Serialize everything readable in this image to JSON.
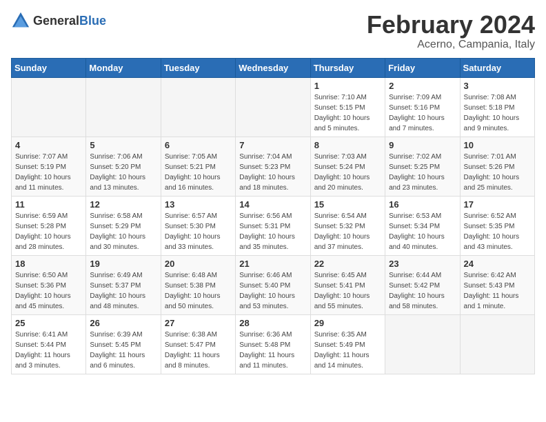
{
  "header": {
    "logo_general": "General",
    "logo_blue": "Blue",
    "main_title": "February 2024",
    "sub_title": "Acerno, Campania, Italy"
  },
  "calendar": {
    "days_of_week": [
      "Sunday",
      "Monday",
      "Tuesday",
      "Wednesday",
      "Thursday",
      "Friday",
      "Saturday"
    ],
    "weeks": [
      [
        {
          "day": "",
          "info": ""
        },
        {
          "day": "",
          "info": ""
        },
        {
          "day": "",
          "info": ""
        },
        {
          "day": "",
          "info": ""
        },
        {
          "day": "1",
          "info": "Sunrise: 7:10 AM\nSunset: 5:15 PM\nDaylight: 10 hours\nand 5 minutes."
        },
        {
          "day": "2",
          "info": "Sunrise: 7:09 AM\nSunset: 5:16 PM\nDaylight: 10 hours\nand 7 minutes."
        },
        {
          "day": "3",
          "info": "Sunrise: 7:08 AM\nSunset: 5:18 PM\nDaylight: 10 hours\nand 9 minutes."
        }
      ],
      [
        {
          "day": "4",
          "info": "Sunrise: 7:07 AM\nSunset: 5:19 PM\nDaylight: 10 hours\nand 11 minutes."
        },
        {
          "day": "5",
          "info": "Sunrise: 7:06 AM\nSunset: 5:20 PM\nDaylight: 10 hours\nand 13 minutes."
        },
        {
          "day": "6",
          "info": "Sunrise: 7:05 AM\nSunset: 5:21 PM\nDaylight: 10 hours\nand 16 minutes."
        },
        {
          "day": "7",
          "info": "Sunrise: 7:04 AM\nSunset: 5:23 PM\nDaylight: 10 hours\nand 18 minutes."
        },
        {
          "day": "8",
          "info": "Sunrise: 7:03 AM\nSunset: 5:24 PM\nDaylight: 10 hours\nand 20 minutes."
        },
        {
          "day": "9",
          "info": "Sunrise: 7:02 AM\nSunset: 5:25 PM\nDaylight: 10 hours\nand 23 minutes."
        },
        {
          "day": "10",
          "info": "Sunrise: 7:01 AM\nSunset: 5:26 PM\nDaylight: 10 hours\nand 25 minutes."
        }
      ],
      [
        {
          "day": "11",
          "info": "Sunrise: 6:59 AM\nSunset: 5:28 PM\nDaylight: 10 hours\nand 28 minutes."
        },
        {
          "day": "12",
          "info": "Sunrise: 6:58 AM\nSunset: 5:29 PM\nDaylight: 10 hours\nand 30 minutes."
        },
        {
          "day": "13",
          "info": "Sunrise: 6:57 AM\nSunset: 5:30 PM\nDaylight: 10 hours\nand 33 minutes."
        },
        {
          "day": "14",
          "info": "Sunrise: 6:56 AM\nSunset: 5:31 PM\nDaylight: 10 hours\nand 35 minutes."
        },
        {
          "day": "15",
          "info": "Sunrise: 6:54 AM\nSunset: 5:32 PM\nDaylight: 10 hours\nand 37 minutes."
        },
        {
          "day": "16",
          "info": "Sunrise: 6:53 AM\nSunset: 5:34 PM\nDaylight: 10 hours\nand 40 minutes."
        },
        {
          "day": "17",
          "info": "Sunrise: 6:52 AM\nSunset: 5:35 PM\nDaylight: 10 hours\nand 43 minutes."
        }
      ],
      [
        {
          "day": "18",
          "info": "Sunrise: 6:50 AM\nSunset: 5:36 PM\nDaylight: 10 hours\nand 45 minutes."
        },
        {
          "day": "19",
          "info": "Sunrise: 6:49 AM\nSunset: 5:37 PM\nDaylight: 10 hours\nand 48 minutes."
        },
        {
          "day": "20",
          "info": "Sunrise: 6:48 AM\nSunset: 5:38 PM\nDaylight: 10 hours\nand 50 minutes."
        },
        {
          "day": "21",
          "info": "Sunrise: 6:46 AM\nSunset: 5:40 PM\nDaylight: 10 hours\nand 53 minutes."
        },
        {
          "day": "22",
          "info": "Sunrise: 6:45 AM\nSunset: 5:41 PM\nDaylight: 10 hours\nand 55 minutes."
        },
        {
          "day": "23",
          "info": "Sunrise: 6:44 AM\nSunset: 5:42 PM\nDaylight: 10 hours\nand 58 minutes."
        },
        {
          "day": "24",
          "info": "Sunrise: 6:42 AM\nSunset: 5:43 PM\nDaylight: 11 hours\nand 1 minute."
        }
      ],
      [
        {
          "day": "25",
          "info": "Sunrise: 6:41 AM\nSunset: 5:44 PM\nDaylight: 11 hours\nand 3 minutes."
        },
        {
          "day": "26",
          "info": "Sunrise: 6:39 AM\nSunset: 5:45 PM\nDaylight: 11 hours\nand 6 minutes."
        },
        {
          "day": "27",
          "info": "Sunrise: 6:38 AM\nSunset: 5:47 PM\nDaylight: 11 hours\nand 8 minutes."
        },
        {
          "day": "28",
          "info": "Sunrise: 6:36 AM\nSunset: 5:48 PM\nDaylight: 11 hours\nand 11 minutes."
        },
        {
          "day": "29",
          "info": "Sunrise: 6:35 AM\nSunset: 5:49 PM\nDaylight: 11 hours\nand 14 minutes."
        },
        {
          "day": "",
          "info": ""
        },
        {
          "day": "",
          "info": ""
        }
      ]
    ]
  }
}
